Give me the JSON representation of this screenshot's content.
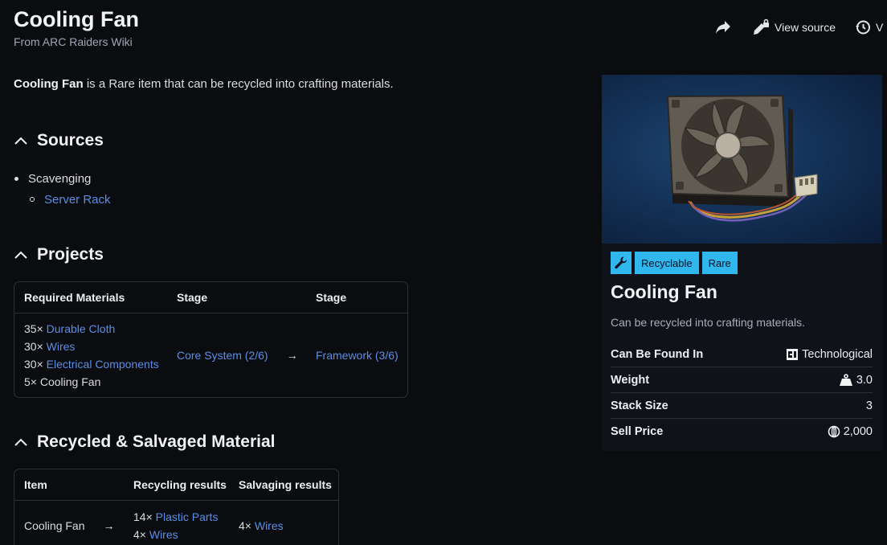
{
  "page": {
    "title": "Cooling Fan",
    "subtitle": "From ARC Raiders Wiki"
  },
  "actions": {
    "view_source": "View source",
    "history_partial": "V"
  },
  "intro": {
    "item_name": "Cooling Fan",
    "text": " is a Rare item that can be recycled into crafting materials."
  },
  "sources": {
    "heading": "Sources",
    "items": [
      {
        "label": "Scavenging",
        "children": [
          "Server Rack"
        ]
      }
    ]
  },
  "projects": {
    "heading": "Projects",
    "headers": [
      "Required Materials",
      "Stage",
      "Stage"
    ],
    "materials": [
      {
        "qty": "35×",
        "name": "Durable Cloth",
        "link": true
      },
      {
        "qty": "30×",
        "name": "Wires",
        "link": true
      },
      {
        "qty": "30×",
        "name": "Electrical Components",
        "link": true
      },
      {
        "qty": "5×",
        "name": "Cooling Fan",
        "link": false
      }
    ],
    "stage_from": "Core System (2/6)",
    "arrow": "→",
    "stage_to": "Framework (3/6)"
  },
  "recycled": {
    "heading": "Recycled & Salvaged Material",
    "headers": [
      "Item",
      "Recycling results",
      "Salvaging results"
    ],
    "item": "Cooling Fan",
    "arrow": "→",
    "recycling": [
      {
        "qty": "14×",
        "name": "Plastic Parts"
      },
      {
        "qty": "4×",
        "name": "Wires"
      }
    ],
    "salvaging": [
      {
        "qty": "4×",
        "name": "Wires"
      }
    ]
  },
  "infobox": {
    "badges": [
      "Recyclable",
      "Rare"
    ],
    "title": "Cooling Fan",
    "description": "Can be recycled into crafting materials.",
    "rows": [
      {
        "key": "Can Be Found In",
        "value": "Technological",
        "icon": "technological-icon"
      },
      {
        "key": "Weight",
        "value": "3.0",
        "icon": "weight-icon"
      },
      {
        "key": "Stack Size",
        "value": "3",
        "icon": ""
      },
      {
        "key": "Sell Price",
        "value": "2,000",
        "icon": "coin-icon"
      }
    ]
  },
  "colors": {
    "accent": "#2fb7ee",
    "link": "#5b8ee6",
    "background": "#0b0c0f"
  }
}
